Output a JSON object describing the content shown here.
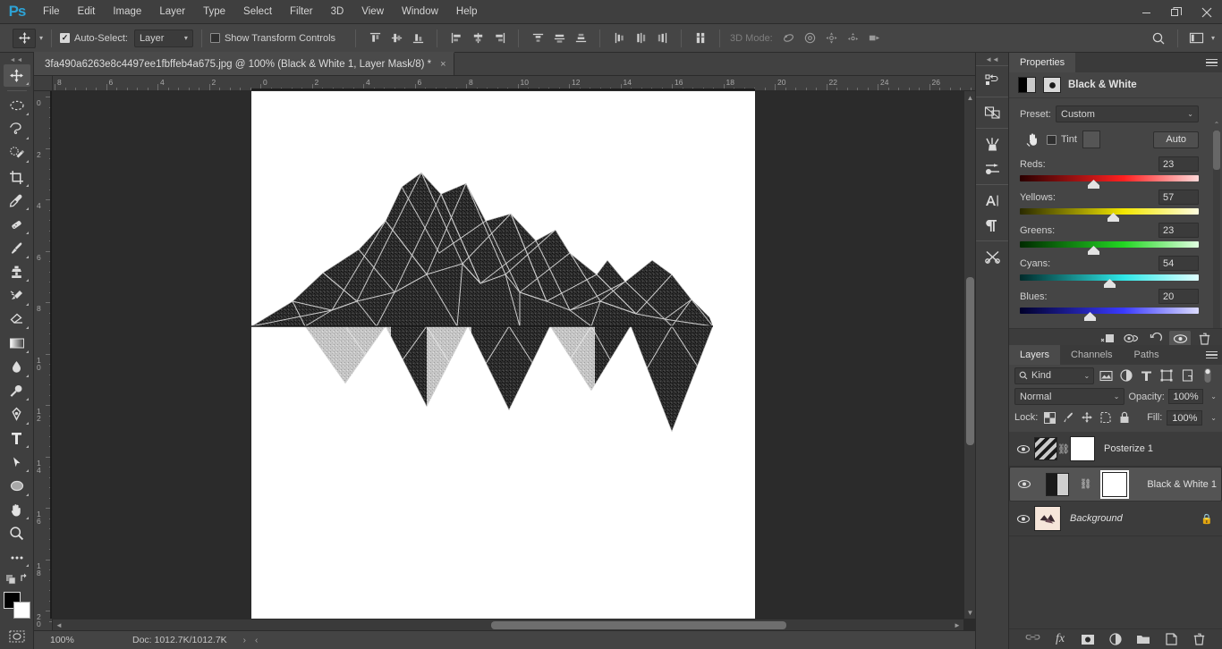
{
  "app": {
    "logo": "Ps"
  },
  "menubar": {
    "items": [
      "File",
      "Edit",
      "Image",
      "Layer",
      "Type",
      "Select",
      "Filter",
      "3D",
      "View",
      "Window",
      "Help"
    ],
    "window_controls": [
      "minimize",
      "restore",
      "close"
    ]
  },
  "options_bar": {
    "tool_icon": "move-tool-icon",
    "auto_select_label": "Auto-Select:",
    "auto_select_checked": true,
    "auto_select_value": "Layer",
    "show_transform_label": "Show Transform Controls",
    "show_transform_checked": false,
    "align_group_1": [
      "align-top-edges-icon",
      "align-vertical-centers-icon",
      "align-bottom-edges-icon"
    ],
    "align_group_2": [
      "align-left-edges-icon",
      "align-horizontal-centers-icon",
      "align-right-edges-icon"
    ],
    "distribute_group_1": [
      "distribute-top-edges-icon",
      "distribute-vertical-centers-icon",
      "distribute-bottom-edges-icon"
    ],
    "distribute_group_2": [
      "distribute-left-edges-icon",
      "distribute-horizontal-centers-icon",
      "distribute-right-edges-icon"
    ],
    "align_to_selection": "align-to-selection-icon",
    "mode_3d_label": "3D Mode:",
    "mode_3d_icons": [
      "orbit-3d-icon",
      "roll-3d-icon",
      "pan-3d-icon",
      "slide-3d-icon",
      "scale-3d-icon"
    ],
    "search_icon": "search-icon",
    "workspace_icon": "workspace-switcher-icon"
  },
  "toolbar": {
    "tools": [
      {
        "name": "move-tool",
        "active": true,
        "has_flyout": true
      },
      {
        "name": "elliptical-marquee-tool",
        "active": false,
        "has_flyout": true
      },
      {
        "name": "lasso-tool",
        "active": false,
        "has_flyout": true
      },
      {
        "name": "quick-selection-tool",
        "active": false,
        "has_flyout": true
      },
      {
        "name": "crop-tool",
        "active": false,
        "has_flyout": true
      },
      {
        "name": "eyedropper-tool",
        "active": false,
        "has_flyout": true
      },
      {
        "name": "spot-healing-brush-tool",
        "active": false,
        "has_flyout": true
      },
      {
        "name": "brush-tool",
        "active": false,
        "has_flyout": true
      },
      {
        "name": "clone-stamp-tool",
        "active": false,
        "has_flyout": true
      },
      {
        "name": "history-brush-tool",
        "active": false,
        "has_flyout": true
      },
      {
        "name": "eraser-tool",
        "active": false,
        "has_flyout": true
      },
      {
        "name": "gradient-tool",
        "active": false,
        "has_flyout": true
      },
      {
        "name": "blur-tool",
        "active": false,
        "has_flyout": true
      },
      {
        "name": "dodge-tool",
        "active": false,
        "has_flyout": true
      },
      {
        "name": "pen-tool",
        "active": false,
        "has_flyout": true
      },
      {
        "name": "horizontal-type-tool",
        "active": false,
        "has_flyout": true
      },
      {
        "name": "path-selection-tool",
        "active": false,
        "has_flyout": true
      },
      {
        "name": "ellipse-tool",
        "active": false,
        "has_flyout": true
      },
      {
        "name": "hand-tool",
        "active": false,
        "has_flyout": true
      },
      {
        "name": "zoom-tool",
        "active": false,
        "has_flyout": false
      },
      {
        "name": "edit-toolbar-tool",
        "active": false,
        "has_flyout": true
      }
    ],
    "quick_mask": "quick-mask-icon",
    "foreground_color": "#000000",
    "background_color": "#ffffff"
  },
  "document": {
    "tab_title": "3fa490a6263e8c4497ee1fbffeb4a675.jpg @ 100% (Black & White 1, Layer Mask/8) *",
    "close_glyph": "×",
    "ruler_h_ticks": [
      "8",
      "6",
      "4",
      "2",
      "0",
      "2",
      "4",
      "6",
      "8",
      "10",
      "12",
      "14",
      "16",
      "18",
      "20",
      "22",
      "24",
      "26"
    ],
    "ruler_v_ticks": [
      "0",
      "2",
      "4",
      "6",
      "8",
      "10",
      "12",
      "14",
      "16",
      "18",
      "20"
    ],
    "canvas_background": "#ffffff",
    "artwork_description": "low-poly triangulated mountain with reflected triangle fringe"
  },
  "status_bar": {
    "zoom": "100%",
    "doc_label": "Doc: 1012.7K/1012.7K",
    "expand_glyph": "›",
    "collapse_glyph": "‹"
  },
  "icon_rail": {
    "groups": [
      [
        "history-icon"
      ],
      [
        "device-preview-icon"
      ],
      [
        "brush-presets-icon",
        "brush-settings-icon"
      ],
      [
        "character-icon",
        "paragraph-icon"
      ],
      [
        "adjustments-icon"
      ]
    ]
  },
  "properties_panel": {
    "tab_label": "Properties",
    "menu_icon": "panel-menu-icon",
    "adjustment_title": "Black & White",
    "adjustment_icon": "black-and-white-icon",
    "mask_icon": "mask-icon",
    "preset_label": "Preset:",
    "preset_value": "Custom",
    "hand_icon": "targeted-adjustment-icon",
    "tint_label": "Tint",
    "tint_checked": false,
    "tint_color": "#555555",
    "auto_button": "Auto",
    "sliders": [
      {
        "label": "Reds:",
        "value": "23",
        "pct": 41,
        "from": "#2a0000",
        "mid": "#ff2020",
        "to": "#ffd8d8"
      },
      {
        "label": "Yellows:",
        "value": "57",
        "pct": 52,
        "from": "#2a2a00",
        "mid": "#f2e600",
        "to": "#fffde0"
      },
      {
        "label": "Greens:",
        "value": "23",
        "pct": 41,
        "from": "#002a00",
        "mid": "#22d622",
        "to": "#e0ffe0"
      },
      {
        "label": "Cyans:",
        "value": "54",
        "pct": 50,
        "from": "#002a2a",
        "mid": "#2ee8e8",
        "to": "#e0ffff"
      },
      {
        "label": "Blues:",
        "value": "20",
        "pct": 39,
        "from": "#00002a",
        "mid": "#3a3aff",
        "to": "#dcdcff"
      }
    ],
    "footer_icons": [
      "clip-to-layer-icon",
      "previous-state-icon",
      "reset-icon",
      "toggle-visibility-icon",
      "delete-icon"
    ]
  },
  "layers_panel": {
    "tabs": [
      {
        "label": "Layers",
        "active": true
      },
      {
        "label": "Channels",
        "active": false
      },
      {
        "label": "Paths",
        "active": false
      }
    ],
    "menu_icon": "panel-menu-icon",
    "filter_label": "Kind",
    "filter_icon": "search-icon",
    "filter_type_icons": [
      "filter-pixel-icon",
      "filter-adjustment-icon",
      "filter-type-icon",
      "filter-shape-icon",
      "filter-smart-object-icon"
    ],
    "filter_toggle": "filter-toggle-icon",
    "blend_mode": "Normal",
    "opacity_label": "Opacity:",
    "opacity_value": "100%",
    "lock_label": "Lock:",
    "lock_icons": [
      "lock-transparent-pixels-icon",
      "lock-image-pixels-icon",
      "lock-position-icon",
      "lock-artboard-icon",
      "lock-all-icon"
    ],
    "fill_label": "Fill:",
    "fill_value": "100%",
    "layers": [
      {
        "name": "Posterize 1",
        "visible": true,
        "selected": false,
        "thumb_type": "posterize-adjustment",
        "linked": true,
        "has_mask": true,
        "mask_active": false,
        "locked": false,
        "italic": false
      },
      {
        "name": "Black & White 1",
        "visible": true,
        "selected": true,
        "thumb_type": "black-and-white-adjustment",
        "linked": true,
        "has_mask": true,
        "mask_active": true,
        "locked": false,
        "italic": false
      },
      {
        "name": "Background",
        "visible": true,
        "selected": false,
        "thumb_type": "photo",
        "linked": false,
        "has_mask": false,
        "mask_active": false,
        "locked": true,
        "italic": true
      }
    ],
    "footer_icons": [
      "link-layers-icon",
      "layer-style-fx-icon",
      "add-layer-mask-icon",
      "new-adjustment-layer-icon",
      "new-group-icon",
      "new-layer-icon",
      "delete-layer-icon"
    ]
  },
  "colors": {
    "menu_bg": "#3f3f3f",
    "options_bg": "#454545",
    "panel_bg": "#454545",
    "canvas_surround": "#2b2b2b",
    "selection_blue": "#2da3d6"
  }
}
